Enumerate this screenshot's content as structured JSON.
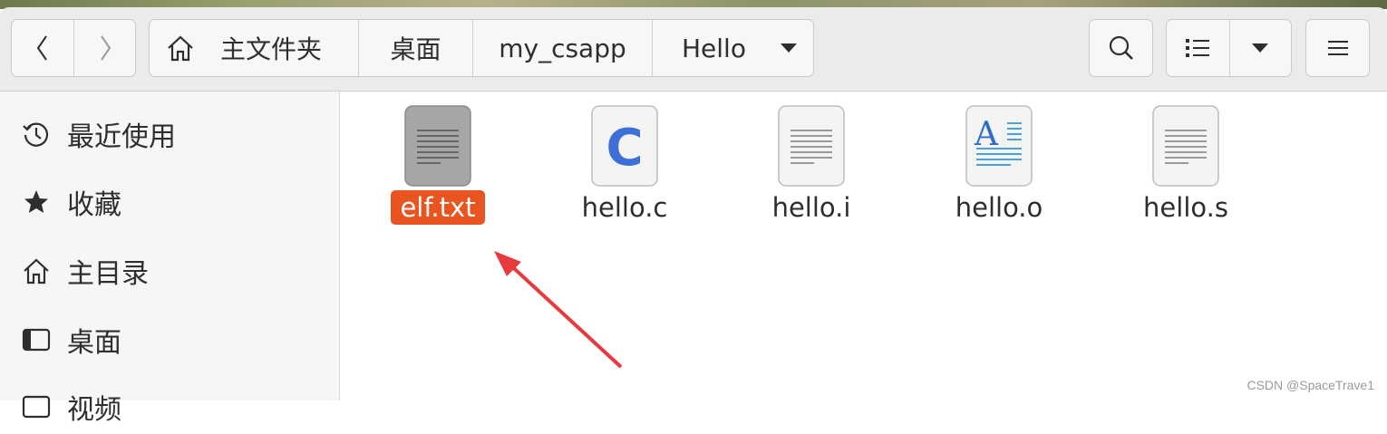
{
  "window": {
    "nav": {
      "back_icon": "chevron-left-icon",
      "forward_icon": "chevron-right-icon"
    },
    "breadcrumbs": [
      {
        "label": "主文件夹",
        "icon": "home-icon"
      },
      {
        "label": "桌面"
      },
      {
        "label": "my_csapp"
      },
      {
        "label": "Hello",
        "dropdown_icon": "triangle-down-icon"
      }
    ],
    "toolbar": {
      "search_icon": "search-icon",
      "view_icon": "list-view-icon",
      "view_menu_icon": "triangle-down-icon",
      "menu_icon": "hamburger-menu-icon"
    }
  },
  "sidebar": {
    "items": [
      {
        "label": "最近使用",
        "icon": "clock-icon"
      },
      {
        "label": "收藏",
        "icon": "star-icon"
      },
      {
        "label": "主目录",
        "icon": "home-icon"
      },
      {
        "label": "桌面",
        "icon": "desktop-icon"
      },
      {
        "label": "视频",
        "icon": "video-icon"
      }
    ]
  },
  "files": [
    {
      "name": "elf.txt",
      "icon": "text-file-icon",
      "selected": true
    },
    {
      "name": "hello.c",
      "icon": "c-source-icon",
      "selected": false
    },
    {
      "name": "hello.i",
      "icon": "text-file-icon",
      "selected": false
    },
    {
      "name": "hello.o",
      "icon": "document-icon",
      "selected": false
    },
    {
      "name": "hello.s",
      "icon": "text-file-icon",
      "selected": false
    }
  ],
  "watermark": "CSDN @SpaceTrave1",
  "colors": {
    "selection": "#e95420",
    "annotation_arrow": "#e8393d",
    "c_icon": "#3d6fd6"
  }
}
